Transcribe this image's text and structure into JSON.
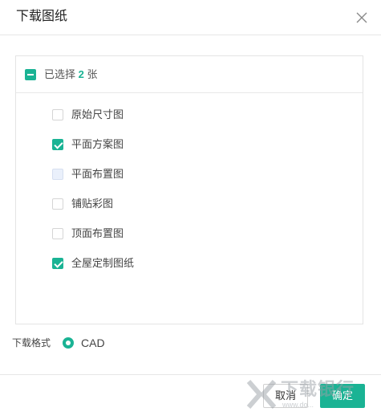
{
  "dialog": {
    "title": "下载图纸",
    "close_icon": "close-icon"
  },
  "selection": {
    "prefix": "已选择",
    "count": "2",
    "suffix": "张"
  },
  "items": [
    {
      "label": "原始尺寸图",
      "state": "unchecked"
    },
    {
      "label": "平面方案图",
      "state": "checked"
    },
    {
      "label": "平面布置图",
      "state": "disabled"
    },
    {
      "label": "铺贴彩图",
      "state": "unchecked"
    },
    {
      "label": "顶面布置图",
      "state": "unchecked"
    },
    {
      "label": "全屋定制图纸",
      "state": "checked"
    }
  ],
  "format": {
    "label": "下载格式",
    "option": "CAD",
    "selected": true
  },
  "footer": {
    "cancel_label": "取消",
    "ok_label": "确定"
  },
  "watermark": {
    "text": "下载银行",
    "sub": "www.do..."
  },
  "colors": {
    "accent": "#1ab394",
    "border": "#e4e4e4",
    "disabled_fill": "#eaf0fb"
  }
}
